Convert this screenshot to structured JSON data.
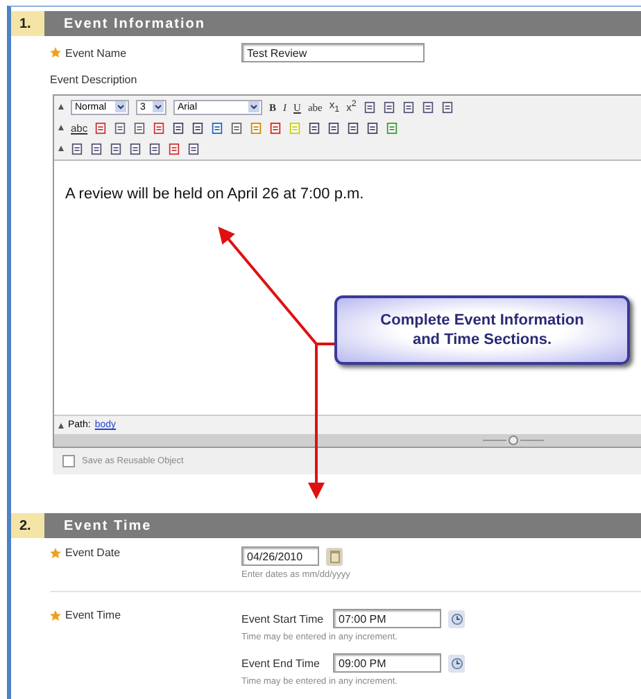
{
  "event_information": {
    "number": "1.",
    "title": "Event Information",
    "event_name": {
      "label": "Event Name",
      "required": true,
      "value": "Test Review"
    },
    "description": {
      "label": "Event Description",
      "toolbar": {
        "paragraph_style": "Normal",
        "font_size": "3",
        "font_family": "Arial",
        "format_buttons": [
          "B",
          "I",
          "U",
          "abe"
        ],
        "script_buttons": [
          "x$_{1}$",
          "x$^{2}$"
        ],
        "spellcheck": "abc"
      },
      "content": "A review will be held on April 26 at 7:00 p.m.",
      "path_label": "Path:",
      "path_link": "body"
    },
    "save_reusable": {
      "label": "Save as Reusable Object",
      "checked": false
    }
  },
  "event_time": {
    "number": "2.",
    "title": "Event Time",
    "event_date": {
      "label": "Event Date",
      "required": true,
      "value": "04/26/2010",
      "hint": "Enter dates as mm/dd/yyyy"
    },
    "event_time": {
      "label": "Event Time",
      "required": true,
      "start": {
        "label": "Event Start Time",
        "value": "07:00 PM",
        "hint": "Time may be entered in any increment."
      },
      "end": {
        "label": "Event End Time",
        "value": "09:00 PM",
        "hint": "Time may be entered in any increment."
      }
    }
  },
  "callout": {
    "text": "Complete Event Information and Time Sections."
  }
}
